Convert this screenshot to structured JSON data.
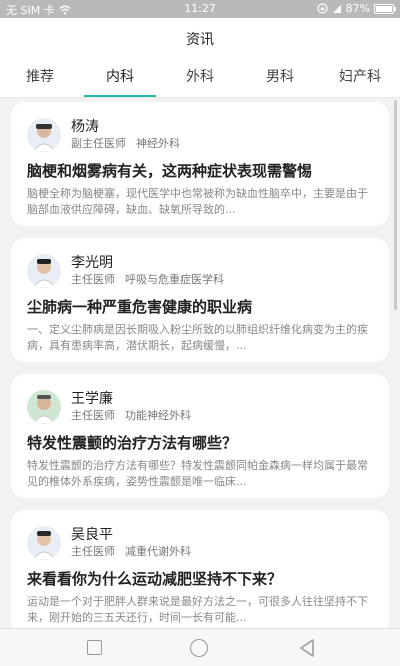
{
  "status_bar": {
    "carrier": "无 SIM 卡",
    "time": "11:27",
    "battery_percent": "87%",
    "battery_level": 0.87
  },
  "header": {
    "title": "资讯"
  },
  "tabs": [
    {
      "label": "推荐"
    },
    {
      "label": "内科"
    },
    {
      "label": "外科"
    },
    {
      "label": "男科"
    },
    {
      "label": "妇产科"
    }
  ],
  "active_tab_index": 1,
  "articles": [
    {
      "author": "杨涛",
      "title_role": "副主任医师",
      "department": "神经外科",
      "headline": "脑梗和烟雾病有关，这两种症状表现需警惕",
      "excerpt": "脑梗全称为脑梗塞，现代医学中也常被称为缺血性脑卒中，主要是由于脑部血液供应障碍，缺血、缺氧所导致的..."
    },
    {
      "author": "李光明",
      "title_role": "主任医师",
      "department": "呼吸与危重症医学科",
      "headline": "尘肺病一种严重危害健康的职业病",
      "excerpt": "一、定义尘肺病是因长期吸入粉尘所致的以肺组织纤维化病变为主的疾病，具有患病率高，潜伏期长，起病缓慢，..."
    },
    {
      "author": "王学廉",
      "title_role": "主任医师",
      "department": "功能神经外科",
      "headline": "特发性震颤的治疗方法有哪些？",
      "excerpt": "特发性震颤的治疗方法有哪些？特发性震颤同帕金森病一样均属于最常见的椎体外系疾病，姿势性震颤是唯一临床..."
    },
    {
      "author": "吴良平",
      "title_role": "主任医师",
      "department": "减重代谢外科",
      "headline": "来看看你为什么运动减肥坚持不下来？",
      "excerpt": "运动是一个对于肥胖人群来说是最好方法之一，可很多人往往坚持不下来，刚开始的三五天还行，时间一长有可能..."
    }
  ],
  "colors": {
    "accent": "#22b7a6",
    "status_bar": "#b9b9b9"
  },
  "nav_icons": [
    "recent-apps-icon",
    "home-icon",
    "back-icon"
  ]
}
